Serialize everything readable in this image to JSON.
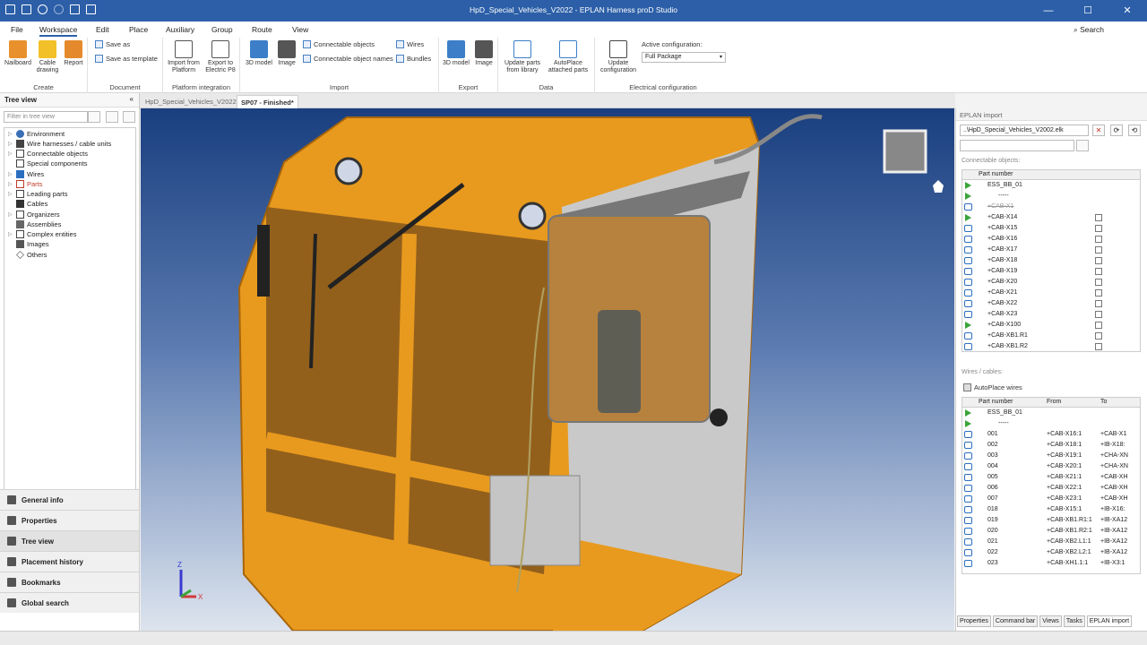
{
  "app": {
    "title": "HpD_Special_Vehicles_V2022 - EPLAN Harness proD Studio",
    "search": "Search"
  },
  "menu": {
    "items": [
      "File",
      "Workspace",
      "Edit",
      "Place",
      "Auxiliary",
      "Group",
      "Route",
      "View"
    ]
  },
  "ribbon": {
    "create": {
      "label": "Create",
      "buttons": [
        "Nailboard",
        "Cable drawing",
        "Report"
      ]
    },
    "document": {
      "label": "Document",
      "save_as": "Save as",
      "save_as_template": "Save as template"
    },
    "platform": {
      "label": "Platform integration",
      "import": "Import from Platform",
      "export": "Export to Electric P8"
    },
    "import": {
      "label": "Import",
      "model": "3D model",
      "image": "Image",
      "connectable_objects": "Connectable objects",
      "connectable_object_names": "Connectable object names",
      "wires": "Wires",
      "bundles": "Bundles"
    },
    "export": {
      "label": "Export",
      "model": "3D model",
      "image": "Image"
    },
    "data": {
      "label": "Data",
      "update_parts": "Update parts from library",
      "autoplace": "AutoPlace attached parts"
    },
    "electrical": {
      "label": "Electrical configuration",
      "update": "Update configuration",
      "active_label": "Active configuration:",
      "active_value": "Full Package"
    }
  },
  "tree": {
    "title": "Tree view",
    "filter_placeholder": "Filter in tree view",
    "items": [
      "Environment",
      "Wire harnesses / cable units",
      "Connectable objects",
      "Special components",
      "Wires",
      "Parts",
      "Leading parts",
      "Cables",
      "Organizers",
      "Assemblies",
      "Complex entities",
      "Images",
      "Others"
    ]
  },
  "nav": [
    "General info",
    "Properties",
    "Tree view",
    "Placement history",
    "Bookmarks",
    "Global search"
  ],
  "doc_tabs": [
    "HpD_Special_Vehicles_V2022*",
    "SP07 - Finished*"
  ],
  "viewport": {
    "axis_z": "Z",
    "axis_x": "X",
    "axis_y": "Y"
  },
  "eplan": {
    "title": "EPLAN import",
    "file": "..\\HpD_Special_Vehicles_V2002.elk",
    "conn_label": "Connectable objects:",
    "col_part": "Part number",
    "conn_rows": [
      "ESS_BB_01",
      "-----",
      "+CAB-X1",
      "+CAB-X14",
      "+CAB-X15",
      "+CAB-X16",
      "+CAB-X17",
      "+CAB-X18",
      "+CAB-X19",
      "+CAB-X20",
      "+CAB-X21",
      "+CAB-X22",
      "+CAB-X23",
      "+CAB-X100",
      "+CAB-XB1.R1",
      "+CAB-XB1.R2"
    ],
    "wires_label": "Wires / cables:",
    "autoplace": "AutoPlace wires",
    "col_from": "From",
    "col_to": "To",
    "wire_rows": [
      {
        "p": "ESS_BB_01",
        "f": "",
        "t": ""
      },
      {
        "p": "-----",
        "f": "",
        "t": ""
      },
      {
        "p": "001",
        "f": "+CAB-X16:1",
        "t": "+CAB-X1"
      },
      {
        "p": "002",
        "f": "+CAB-X18:1",
        "t": "+IB-X18:"
      },
      {
        "p": "003",
        "f": "+CAB-X19:1",
        "t": "+CHA-XN"
      },
      {
        "p": "004",
        "f": "+CAB-X20:1",
        "t": "+CHA-XN"
      },
      {
        "p": "005",
        "f": "+CAB-X21:1",
        "t": "+CAB-XH"
      },
      {
        "p": "006",
        "f": "+CAB-X22:1",
        "t": "+CAB-XH"
      },
      {
        "p": "007",
        "f": "+CAB-X23:1",
        "t": "+CAB-XH"
      },
      {
        "p": "018",
        "f": "+CAB-X15:1",
        "t": "+IB-X16:"
      },
      {
        "p": "019",
        "f": "+CAB-XB1.R1:1",
        "t": "+IB-XA12"
      },
      {
        "p": "020",
        "f": "+CAB-XB1.R2:1",
        "t": "+IB-XA12"
      },
      {
        "p": "021",
        "f": "+CAB-XB2.L1:1",
        "t": "+IB-XA12"
      },
      {
        "p": "022",
        "f": "+CAB-XB2.L2:1",
        "t": "+IB-XA12"
      },
      {
        "p": "023",
        "f": "+CAB-XH1.1:1",
        "t": "+IB-X3:1"
      }
    ]
  },
  "bottom_tabs": [
    "Properties",
    "Command bar",
    "Views",
    "Tasks",
    "EPLAN import"
  ]
}
